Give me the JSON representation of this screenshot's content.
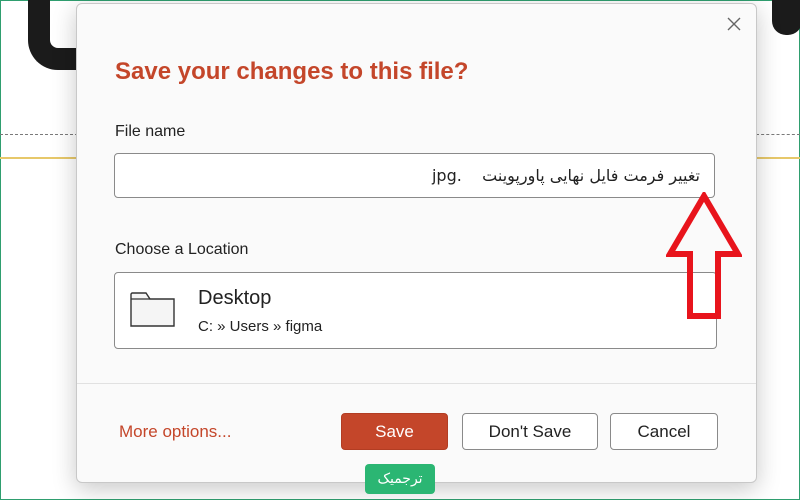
{
  "dialog": {
    "title": "Save your changes to this file?",
    "file_name_label": "File name",
    "file_name_value": "تغییر فرمت فایل نهایی پاورپوینت    .jpg",
    "location_label": "Choose a Location",
    "location": {
      "name": "Desktop",
      "path": "C: » Users » figma"
    },
    "more_options": "More options...",
    "buttons": {
      "save": "Save",
      "dont_save": "Don't Save",
      "cancel": "Cancel"
    }
  },
  "annotation": {
    "arrow_color": "#e8141c"
  },
  "watermark": {
    "text": "ترجمیک"
  },
  "colors": {
    "accent": "#c4462a",
    "watermark_bg": "#2bb673"
  },
  "icons": {
    "close": "close-icon",
    "folder": "folder-icon",
    "arrow": "up-arrow-icon"
  }
}
